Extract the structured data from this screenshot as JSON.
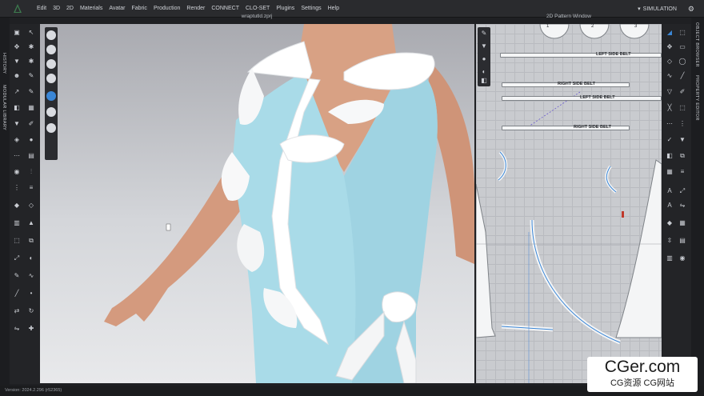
{
  "menu": {
    "items": [
      "Edit",
      "3D",
      "2D",
      "Materials",
      "Avatar",
      "Fabric",
      "Production",
      "Render",
      "CONNECT",
      "CLO-SET",
      "Plugins",
      "Settings",
      "Help"
    ],
    "mode_label": "SIMULATION"
  },
  "left_tabs": [
    "HISTORY",
    "MODULAR LIBRARY"
  ],
  "right_tabs": [
    "OBJECT BROWSER",
    "PROPERTY EDITOR"
  ],
  "viewport": {
    "title": "wraptutld.zprj"
  },
  "pattern_window": {
    "title": "2D Pattern Window",
    "piece_numbers": [
      "1",
      "2",
      "3"
    ],
    "belt_labels": [
      "LEFT SIDE BELT",
      "RIGHT SIDE BELT",
      "LEFT SIDE BELT",
      "RIGHT SIDE BELT"
    ]
  },
  "status": {
    "version": "Version: 2024.2.296 (r52365)"
  },
  "watermark": {
    "main": "CGer.com",
    "sub": "CG资源 CG网站"
  },
  "colors": {
    "dress": "#a9d9e6",
    "ruffle": "#ffffff",
    "accent": "#3a86d6"
  },
  "icons": [
    "gear-icon",
    "chevron-down-icon",
    "close-icon",
    "select-icon",
    "pen-icon",
    "avatar-icon",
    "fabric-icon"
  ]
}
